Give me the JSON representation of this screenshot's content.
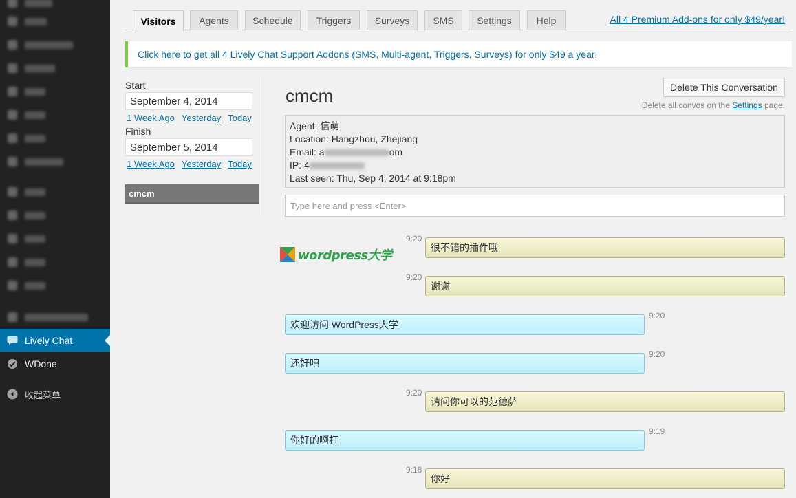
{
  "sidebar": {
    "items": [
      {
        "label": "Lively Chat",
        "icon": "speech-bubble-icon",
        "active": true
      },
      {
        "label": "WDone",
        "icon": "wdone-icon",
        "active": false
      },
      {
        "label": "收起菜单",
        "icon": "collapse-arrow-icon",
        "active": false
      }
    ]
  },
  "tabs": [
    {
      "label": "Visitors",
      "active": true
    },
    {
      "label": "Agents"
    },
    {
      "label": "Schedule"
    },
    {
      "label": "Triggers"
    },
    {
      "label": "Surveys"
    },
    {
      "label": "SMS"
    },
    {
      "label": "Settings"
    },
    {
      "label": "Help"
    }
  ],
  "premium_link": "All 4 Premium Add-ons for only $49/year!",
  "notice": "Click here to get all 4 Lively Chat Support Addons (SMS, Multi-agent, Triggers, Surveys) for only $49 a year!",
  "filters": {
    "start_label": "Start",
    "start_value": "September 4, 2014",
    "finish_label": "Finish",
    "finish_value": "September 5, 2014",
    "quick": {
      "week": "1 Week Ago",
      "yesterday": "Yesterday",
      "today": "Today"
    }
  },
  "conversation_list": [
    {
      "name": "cmcm"
    }
  ],
  "conversation": {
    "title": "cmcm",
    "delete_button": "Delete This Conversation",
    "delete_note_prefix": "Delete all convos on the",
    "delete_note_link": "Settings",
    "delete_note_suffix": "page.",
    "info": {
      "agent": "Agent: 信萌",
      "location": "Location: Hangzhou, Zhejiang",
      "email_prefix": "Email: a",
      "email_suffix": "om",
      "ip_prefix": "IP: 4",
      "last_seen": "Last seen: Thu, Sep 4, 2014 at 9:18pm"
    },
    "input_placeholder": "Type here and press <Enter>",
    "watermark": "wordpress大学",
    "messages": [
      {
        "from": "visitor",
        "time": "9:20",
        "text": "很不错的插件哦"
      },
      {
        "from": "visitor",
        "time": "9:20",
        "text": "谢谢"
      },
      {
        "from": "agent",
        "time": "9:20",
        "text": "欢迎访问 WordPress大学"
      },
      {
        "from": "agent",
        "time": "9:20",
        "text": "还好吧"
      },
      {
        "from": "visitor",
        "time": "9:20",
        "text": "请问你可以的范德萨"
      },
      {
        "from": "agent",
        "time": "9:19",
        "text": "你好的啊打"
      },
      {
        "from": "visitor",
        "time": "9:18",
        "text": "你好"
      }
    ]
  }
}
